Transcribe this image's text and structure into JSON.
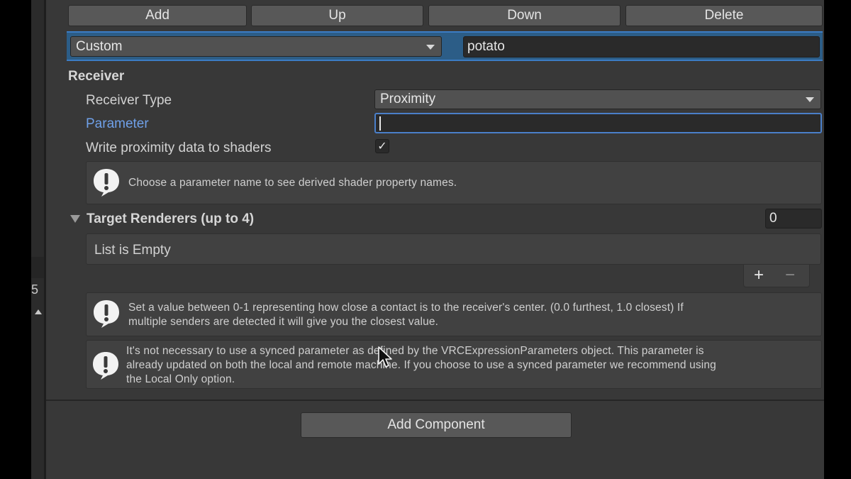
{
  "toolbar": {
    "add_label": "Add",
    "up_label": "Up",
    "down_label": "Down",
    "delete_label": "Delete"
  },
  "selected_row": {
    "type_value": "Custom",
    "name_value": "potato"
  },
  "receiver": {
    "section_title": "Receiver",
    "receiver_type_label": "Receiver Type",
    "receiver_type_value": "Proximity",
    "parameter_label": "Parameter",
    "parameter_value": "",
    "write_proximity_label": "Write proximity data to shaders",
    "write_proximity_checked": true,
    "checkmark": "✓",
    "help_shader": "Choose a parameter name to see derived shader property names."
  },
  "target_renderers": {
    "title": "Target Renderers (up to 4)",
    "count": "0",
    "empty_text": "List is Empty",
    "add_symbol": "+",
    "remove_symbol": "−"
  },
  "help_messages": {
    "proximity_line1": "Set a value between 0-1 representing how close a contact is to the receiver's center. (0.0 furthest, 1.0 closest)  If",
    "proximity_line2": "multiple senders are detected it will give you the closest value.",
    "synced_line1": "It's not necessary to use a synced parameter as defined by the VRCExpressionParameters object.  This parameter is",
    "synced_line2": "already updated on both the local and remote machine.  If you choose to use a synced parameter we recommend using",
    "synced_line3": "the Local Only option."
  },
  "add_component_label": "Add Component",
  "left_panel": {
    "digit": "5"
  },
  "colors": {
    "inspector_bg": "#383838",
    "selection_bg": "#2c5d87",
    "selection_border": "#3b7cc4",
    "parameter_label": "#6fa0e8",
    "focus_border": "#4a7fc9"
  },
  "icons": {
    "warning": "warning-icon",
    "foldout": "foldout-arrow-icon",
    "dropdown": "chevron-down-icon",
    "cursor": "mouse-cursor-icon"
  }
}
